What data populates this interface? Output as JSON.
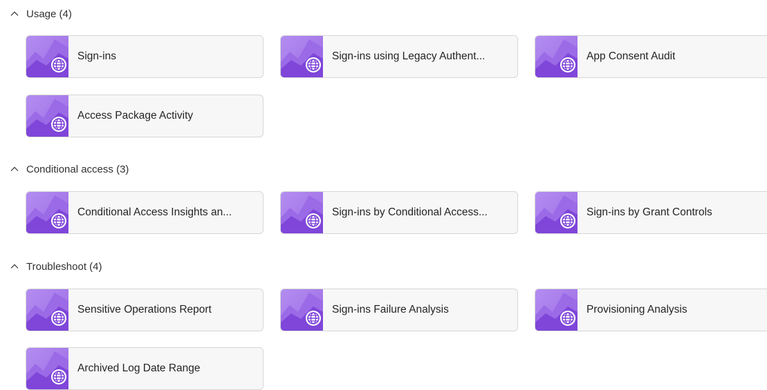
{
  "sections": [
    {
      "title": "Usage (4)",
      "items": [
        {
          "label": "Sign-ins"
        },
        {
          "label": "Sign-ins using Legacy Authent..."
        },
        {
          "label": "App Consent Audit"
        },
        {
          "label": "Access Package Activity"
        }
      ]
    },
    {
      "title": "Conditional access (3)",
      "items": [
        {
          "label": "Conditional Access Insights an..."
        },
        {
          "label": "Sign-ins by Conditional Access..."
        },
        {
          "label": "Sign-ins by Grant Controls"
        }
      ]
    },
    {
      "title": "Troubleshoot (4)",
      "items": [
        {
          "label": "Sensitive Operations Report"
        },
        {
          "label": "Sign-ins Failure Analysis"
        },
        {
          "label": "Provisioning Analysis"
        },
        {
          "label": "Archived Log Date Range"
        }
      ]
    }
  ],
  "icons": {
    "section_toggle": "chevron-up-icon",
    "workbook_tile": "workbook-globe-icon"
  },
  "colors": {
    "thumb_light": "#b48ef0",
    "thumb_mid": "#9b6ae6",
    "thumb_dark": "#7a3fd6",
    "tile_bg": "#f7f7f7",
    "tile_border": "#d6d6d6"
  }
}
